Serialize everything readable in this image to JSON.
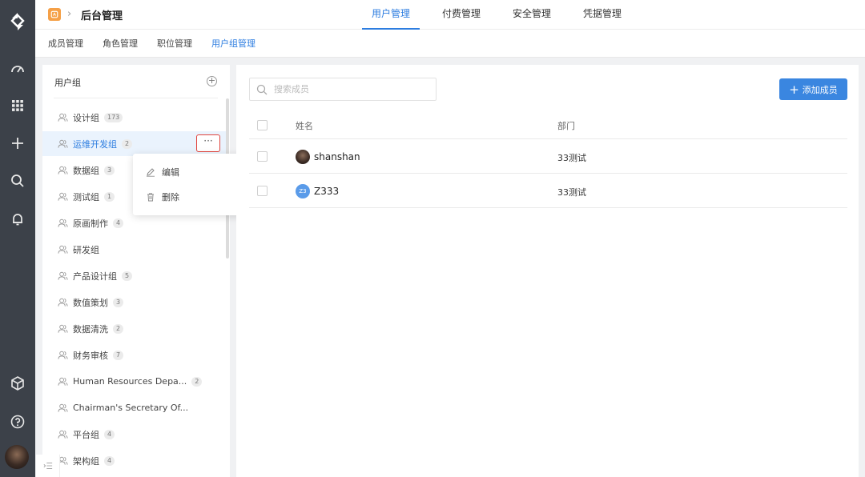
{
  "app": {
    "title": "后台管理"
  },
  "top_tabs": [
    "用户管理",
    "付费管理",
    "安全管理",
    "凭据管理"
  ],
  "top_tab_active": 0,
  "sub_tabs": [
    "成员管理",
    "角色管理",
    "职位管理",
    "用户组管理"
  ],
  "sub_tab_active": 3,
  "group_panel": {
    "title": "用户组",
    "groups": [
      {
        "name": "设计组",
        "count": "173"
      },
      {
        "name": "运维开发组",
        "count": "2"
      },
      {
        "name": "数据组",
        "count": "3"
      },
      {
        "name": "测试组",
        "count": "1"
      },
      {
        "name": "原画制作",
        "count": "4"
      },
      {
        "name": "研发组",
        "count": ""
      },
      {
        "name": "产品设计组",
        "count": "5"
      },
      {
        "name": "数值策划",
        "count": "3"
      },
      {
        "name": "数据清洗",
        "count": "2"
      },
      {
        "name": "财务审核",
        "count": "7"
      },
      {
        "name": "Human Resources Depa...",
        "count": "2"
      },
      {
        "name": "Chairman's Secretary Of...",
        "count": ""
      },
      {
        "name": "平台组",
        "count": "4"
      },
      {
        "name": "架构组",
        "count": "4"
      }
    ],
    "selected_index": 1,
    "more_label": "···"
  },
  "context_menu": {
    "edit": "编辑",
    "delete": "删除"
  },
  "search": {
    "placeholder": "搜索成员"
  },
  "add_member_label": "添加成员",
  "table": {
    "columns": [
      "姓名",
      "部门"
    ],
    "rows": [
      {
        "name": "shanshan",
        "dept": "33测试",
        "avatar": "photo"
      },
      {
        "name": "Z333",
        "dept": "33测试",
        "avatar": "initials",
        "initials": "Z3"
      }
    ]
  },
  "colors": {
    "accent": "#2d7de0",
    "rail": "#3c4149",
    "highlight_border": "#e0443e",
    "app_icon": "#f5a047"
  }
}
